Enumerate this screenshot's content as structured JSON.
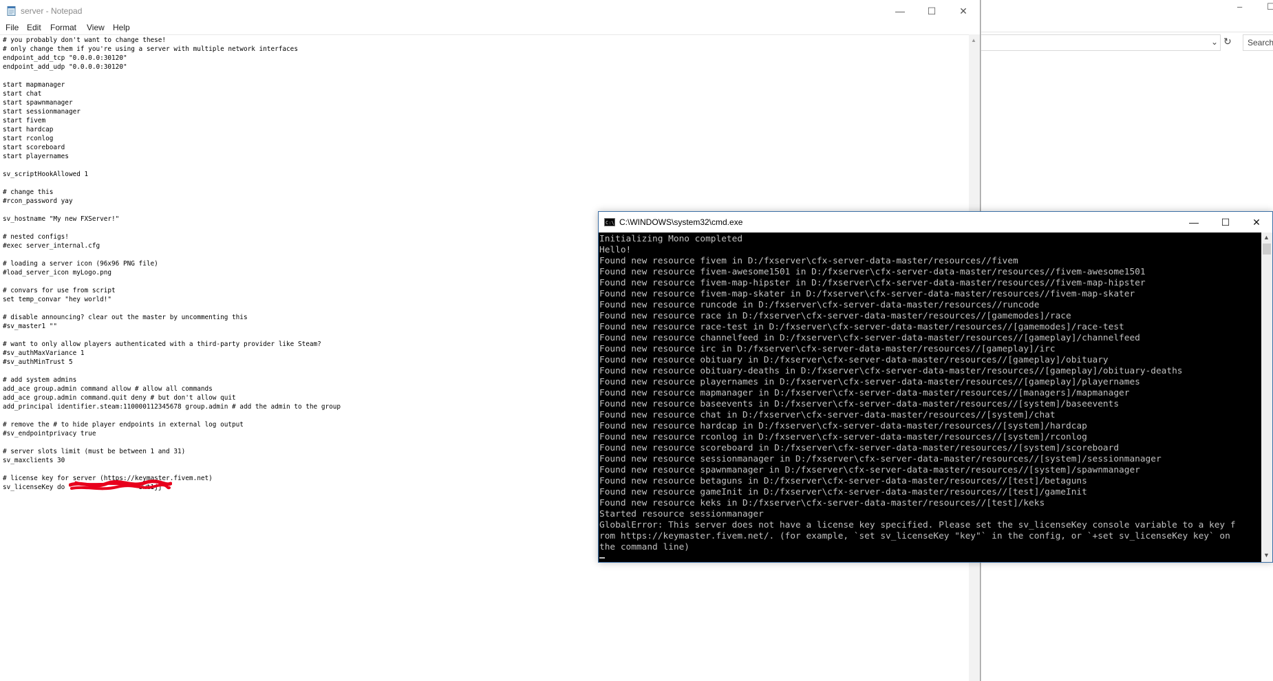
{
  "explorer": {
    "min_glyph": "–",
    "max_glyph": "☐",
    "search_placeholder": "Search",
    "refresh_glyph": "↻",
    "chevron_glyph": "⌄"
  },
  "notepad": {
    "title": "server - Notepad",
    "window_controls": {
      "minimize": "—",
      "maximize": "☐",
      "close": "✕"
    },
    "menu": {
      "file": "File",
      "edit": "Edit",
      "format": "Format",
      "view": "View",
      "help": "Help"
    },
    "content": "# you probably don't want to change these!\n# only change them if you're using a server with multiple network interfaces\nendpoint_add_tcp \"0.0.0.0:30120\"\nendpoint_add_udp \"0.0.0.0:30120\"\n\nstart mapmanager\nstart chat\nstart spawnmanager\nstart sessionmanager\nstart fivem\nstart hardcap\nstart rconlog\nstart scoreboard\nstart playernames\n\nsv_scriptHookAllowed 1\n\n# change this\n#rcon_password yay\n\nsv_hostname \"My new FXServer!\"\n\n# nested configs!\n#exec server_internal.cfg\n\n# loading a server icon (96x96 PNG file)\n#load_server_icon myLogo.png\n\n# convars for use from script\nset temp_convar \"hey world!\"\n\n# disable announcing? clear out the master by uncommenting this\n#sv_master1 \"\"\n\n# want to only allow players authenticated with a third-party provider like Steam?\n#sv_authMaxVariance 1\n#sv_authMinTrust 5\n\n# add system admins\nadd_ace group.admin command allow # allow all commands\nadd_ace group.admin command.quit deny # but don't allow quit\nadd_principal identifier.steam:110000112345678 group.admin # add the admin to the group\n\n# remove the # to hide player endpoints in external log output\n#sv_endpointprivacy true\n\n# server slots limit (must be between 1 and 31)\nsv_maxclients 30\n\n# license key for server (https://keymaster.fivem.net)\nsv_licenseKey do                   8wt1jj"
  },
  "cmd": {
    "title": "C:\\WINDOWS\\system32\\cmd.exe",
    "window_controls": {
      "minimize": "—",
      "maximize": "☐",
      "close": "✕"
    },
    "output": "Initializing Mono completed\nHello!\nFound new resource fivem in D:/fxserver\\cfx-server-data-master/resources//fivem\nFound new resource fivem-awesome1501 in D:/fxserver\\cfx-server-data-master/resources//fivem-awesome1501\nFound new resource fivem-map-hipster in D:/fxserver\\cfx-server-data-master/resources//fivem-map-hipster\nFound new resource fivem-map-skater in D:/fxserver\\cfx-server-data-master/resources//fivem-map-skater\nFound new resource runcode in D:/fxserver\\cfx-server-data-master/resources//runcode\nFound new resource race in D:/fxserver\\cfx-server-data-master/resources//[gamemodes]/race\nFound new resource race-test in D:/fxserver\\cfx-server-data-master/resources//[gamemodes]/race-test\nFound new resource channelfeed in D:/fxserver\\cfx-server-data-master/resources//[gameplay]/channelfeed\nFound new resource irc in D:/fxserver\\cfx-server-data-master/resources//[gameplay]/irc\nFound new resource obituary in D:/fxserver\\cfx-server-data-master/resources//[gameplay]/obituary\nFound new resource obituary-deaths in D:/fxserver\\cfx-server-data-master/resources//[gameplay]/obituary-deaths\nFound new resource playernames in D:/fxserver\\cfx-server-data-master/resources//[gameplay]/playernames\nFound new resource mapmanager in D:/fxserver\\cfx-server-data-master/resources//[managers]/mapmanager\nFound new resource baseevents in D:/fxserver\\cfx-server-data-master/resources//[system]/baseevents\nFound new resource chat in D:/fxserver\\cfx-server-data-master/resources//[system]/chat\nFound new resource hardcap in D:/fxserver\\cfx-server-data-master/resources//[system]/hardcap\nFound new resource rconlog in D:/fxserver\\cfx-server-data-master/resources//[system]/rconlog\nFound new resource scoreboard in D:/fxserver\\cfx-server-data-master/resources//[system]/scoreboard\nFound new resource sessionmanager in D:/fxserver\\cfx-server-data-master/resources//[system]/sessionmanager\nFound new resource spawnmanager in D:/fxserver\\cfx-server-data-master/resources//[system]/spawnmanager\nFound new resource betaguns in D:/fxserver\\cfx-server-data-master/resources//[test]/betaguns\nFound new resource gameInit in D:/fxserver\\cfx-server-data-master/resources//[test]/gameInit\nFound new resource keks in D:/fxserver\\cfx-server-data-master/resources//[test]/keks\nStarted resource sessionmanager\nGlobalError: This server does not have a license key specified. Please set the sv_licenseKey console variable to a key f\nrom https://keymaster.fivem.net/. (for example, `set sv_licenseKey \"key\"` in the config, or `+set sv_licenseKey key` on\nthe command line)"
  },
  "colors": {
    "console_bg": "#000000",
    "console_fg": "#c0c0c0",
    "redaction": "#e8001c"
  }
}
